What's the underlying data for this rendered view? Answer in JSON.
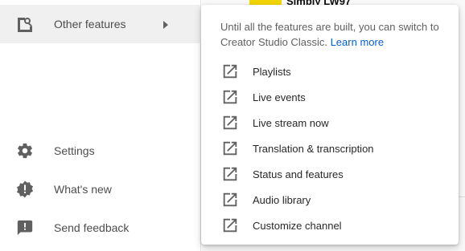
{
  "sidebar": {
    "other_features": {
      "label": "Other features",
      "icon": "other-features-icon"
    },
    "settings": {
      "label": "Settings",
      "icon": "gear-icon"
    },
    "whats_new": {
      "label": "What's new",
      "icon": "alert-badge-icon"
    },
    "send_feedback": {
      "label": "Send feedback",
      "icon": "feedback-icon"
    }
  },
  "background": {
    "channel_title": "Simply LW97",
    "accent": "#f2d500"
  },
  "popup": {
    "note": "Until all the features are built, you can switch to Creator Studio Classic.",
    "learn_more": "Learn more",
    "items": [
      {
        "label": "Playlists",
        "icon": "open-in-new-icon"
      },
      {
        "label": "Live events",
        "icon": "open-in-new-icon"
      },
      {
        "label": "Live stream now",
        "icon": "open-in-new-icon"
      },
      {
        "label": "Translation & transcription",
        "icon": "open-in-new-icon"
      },
      {
        "label": "Status and features",
        "icon": "open-in-new-icon"
      },
      {
        "label": "Audio library",
        "icon": "open-in-new-icon"
      },
      {
        "label": "Customize channel",
        "icon": "open-in-new-icon"
      }
    ]
  },
  "colors": {
    "link": "#065fd4",
    "active_bg": "#f0f0f0",
    "icon": "#606060"
  }
}
